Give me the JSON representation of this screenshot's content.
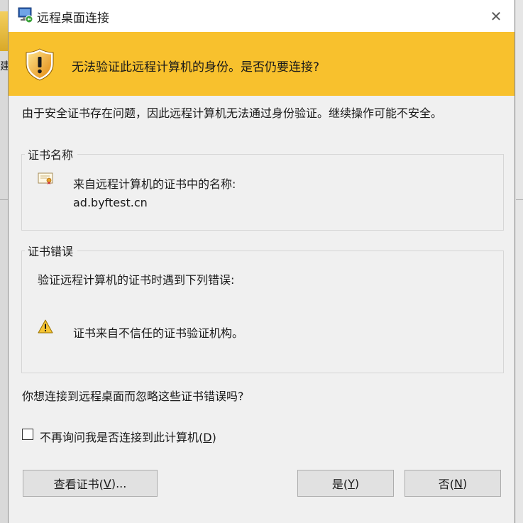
{
  "window": {
    "title": "远程桌面连接",
    "close_glyph": "✕"
  },
  "desktop": {
    "edge_char": "建"
  },
  "banner": {
    "message": "无法验证此远程计算机的身份。是否仍要连接?",
    "icon": "security-warning-shield-icon"
  },
  "description": "由于安全证书存在问题，因此远程计算机无法通过身份验证。继续操作可能不安全。",
  "certificate_name": {
    "legend": "证书名称",
    "label": "来自远程计算机的证书中的名称:",
    "value": "ad.byftest.cn",
    "icon": "certificate-icon"
  },
  "certificate_errors": {
    "legend": "证书错误",
    "intro": "验证远程计算机的证书时遇到下列错误:",
    "items": [
      "证书来自不信任的证书验证机构。"
    ],
    "icon": "warning-triangle-icon"
  },
  "question": "你想连接到远程桌面而忽略这些证书错误吗?",
  "checkbox": {
    "label_prefix": "不再询问我是否连接到此计算机(",
    "label_key": "D",
    "label_suffix": ")",
    "checked": false
  },
  "buttons": {
    "view": {
      "prefix": "查看证书(",
      "key": "V",
      "suffix": ")..."
    },
    "yes": {
      "prefix": "是(",
      "key": "Y",
      "suffix": ")"
    },
    "no": {
      "prefix": "否(",
      "key": "N",
      "suffix": ")"
    }
  },
  "colors": {
    "banner": "#f8c12d",
    "dialog_bg": "#f0f0f0",
    "button_bg": "#e1e1e1",
    "button_border": "#adadad"
  }
}
